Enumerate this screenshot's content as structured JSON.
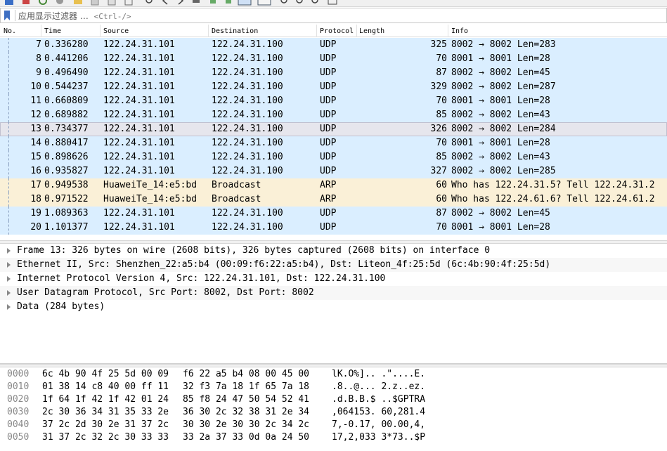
{
  "filter": {
    "placeholder": "应用显示过滤器 … <Ctrl-/>",
    "label": "应用显示过滤器 …",
    "shortcut": "<Ctrl-/>"
  },
  "packet_list": {
    "columns": [
      "No.",
      "Time",
      "Source",
      "Destination",
      "Protocol",
      "Length",
      "Info"
    ],
    "rows": [
      {
        "no": "7",
        "time": "0.336280",
        "src": "122.24.31.101",
        "dst": "122.24.31.100",
        "proto": "UDP",
        "len": "325",
        "info": "8002 → 8002 Len=283",
        "type": "udp"
      },
      {
        "no": "8",
        "time": "0.441206",
        "src": "122.24.31.101",
        "dst": "122.24.31.100",
        "proto": "UDP",
        "len": "70",
        "info": "8001 → 8001 Len=28",
        "type": "udp"
      },
      {
        "no": "9",
        "time": "0.496490",
        "src": "122.24.31.101",
        "dst": "122.24.31.100",
        "proto": "UDP",
        "len": "87",
        "info": "8002 → 8002 Len=45",
        "type": "udp"
      },
      {
        "no": "10",
        "time": "0.544237",
        "src": "122.24.31.101",
        "dst": "122.24.31.100",
        "proto": "UDP",
        "len": "329",
        "info": "8002 → 8002 Len=287",
        "type": "udp"
      },
      {
        "no": "11",
        "time": "0.660809",
        "src": "122.24.31.101",
        "dst": "122.24.31.100",
        "proto": "UDP",
        "len": "70",
        "info": "8001 → 8001 Len=28",
        "type": "udp"
      },
      {
        "no": "12",
        "time": "0.689882",
        "src": "122.24.31.101",
        "dst": "122.24.31.100",
        "proto": "UDP",
        "len": "85",
        "info": "8002 → 8002 Len=43",
        "type": "udp"
      },
      {
        "no": "13",
        "time": "0.734377",
        "src": "122.24.31.101",
        "dst": "122.24.31.100",
        "proto": "UDP",
        "len": "326",
        "info": "8002 → 8002 Len=284",
        "type": "sel"
      },
      {
        "no": "14",
        "time": "0.880417",
        "src": "122.24.31.101",
        "dst": "122.24.31.100",
        "proto": "UDP",
        "len": "70",
        "info": "8001 → 8001 Len=28",
        "type": "udp"
      },
      {
        "no": "15",
        "time": "0.898626",
        "src": "122.24.31.101",
        "dst": "122.24.31.100",
        "proto": "UDP",
        "len": "85",
        "info": "8002 → 8002 Len=43",
        "type": "udp"
      },
      {
        "no": "16",
        "time": "0.935827",
        "src": "122.24.31.101",
        "dst": "122.24.31.100",
        "proto": "UDP",
        "len": "327",
        "info": "8002 → 8002 Len=285",
        "type": "udp"
      },
      {
        "no": "17",
        "time": "0.949538",
        "src": "HuaweiTe_14:e5:bd",
        "dst": "Broadcast",
        "proto": "ARP",
        "len": "60",
        "info": "Who has 122.24.31.5? Tell 122.24.31.2",
        "type": "arp"
      },
      {
        "no": "18",
        "time": "0.971522",
        "src": "HuaweiTe_14:e5:bd",
        "dst": "Broadcast",
        "proto": "ARP",
        "len": "60",
        "info": "Who has 122.24.61.6? Tell 122.24.61.2",
        "type": "arp"
      },
      {
        "no": "19",
        "time": "1.089363",
        "src": "122.24.31.101",
        "dst": "122.24.31.100",
        "proto": "UDP",
        "len": "87",
        "info": "8002 → 8002 Len=45",
        "type": "udp"
      },
      {
        "no": "20",
        "time": "1.101377",
        "src": "122.24.31.101",
        "dst": "122.24.31.100",
        "proto": "UDP",
        "len": "70",
        "info": "8001 → 8001 Len=28",
        "type": "udp"
      }
    ]
  },
  "details": [
    "Frame 13: 326 bytes on wire (2608 bits), 326 bytes captured (2608 bits) on interface 0",
    "Ethernet II, Src: Shenzhen_22:a5:b4 (00:09:f6:22:a5:b4), Dst: Liteon_4f:25:5d (6c:4b:90:4f:25:5d)",
    "Internet Protocol Version 4, Src: 122.24.31.101, Dst: 122.24.31.100",
    "User Datagram Protocol, Src Port: 8002, Dst Port: 8002",
    "Data (284 bytes)"
  ],
  "bytes": [
    {
      "off": "0000",
      "hex1": "6c 4b 90 4f 25 5d 00 09",
      "hex2": "f6 22 a5 b4 08 00 45 00",
      "asc": "lK.O%].. .\"....E."
    },
    {
      "off": "0010",
      "hex1": "01 38 14 c8 40 00 ff 11",
      "hex2": "32 f3 7a 18 1f 65 7a 18",
      "asc": ".8..@... 2.z..ez."
    },
    {
      "off": "0020",
      "hex1": "1f 64 1f 42 1f 42 01 24",
      "hex2": "85 f8 24 47 50 54 52 41",
      "asc": ".d.B.B.$ ..$GPTRA"
    },
    {
      "off": "0030",
      "hex1": "2c 30 36 34 31 35 33 2e",
      "hex2": "36 30 2c 32 38 31 2e 34",
      "asc": ",064153. 60,281.4"
    },
    {
      "off": "0040",
      "hex1": "37 2c 2d 30 2e 31 37 2c",
      "hex2": "30 30 2e 30 30 2c 34 2c",
      "asc": "7,-0.17, 00.00,4,"
    },
    {
      "off": "0050",
      "hex1": "31 37 2c 32 2c 30 33 33",
      "hex2": "33 2a 37 33 0d 0a 24 50",
      "asc": "17,2,033 3*73..$P"
    }
  ]
}
